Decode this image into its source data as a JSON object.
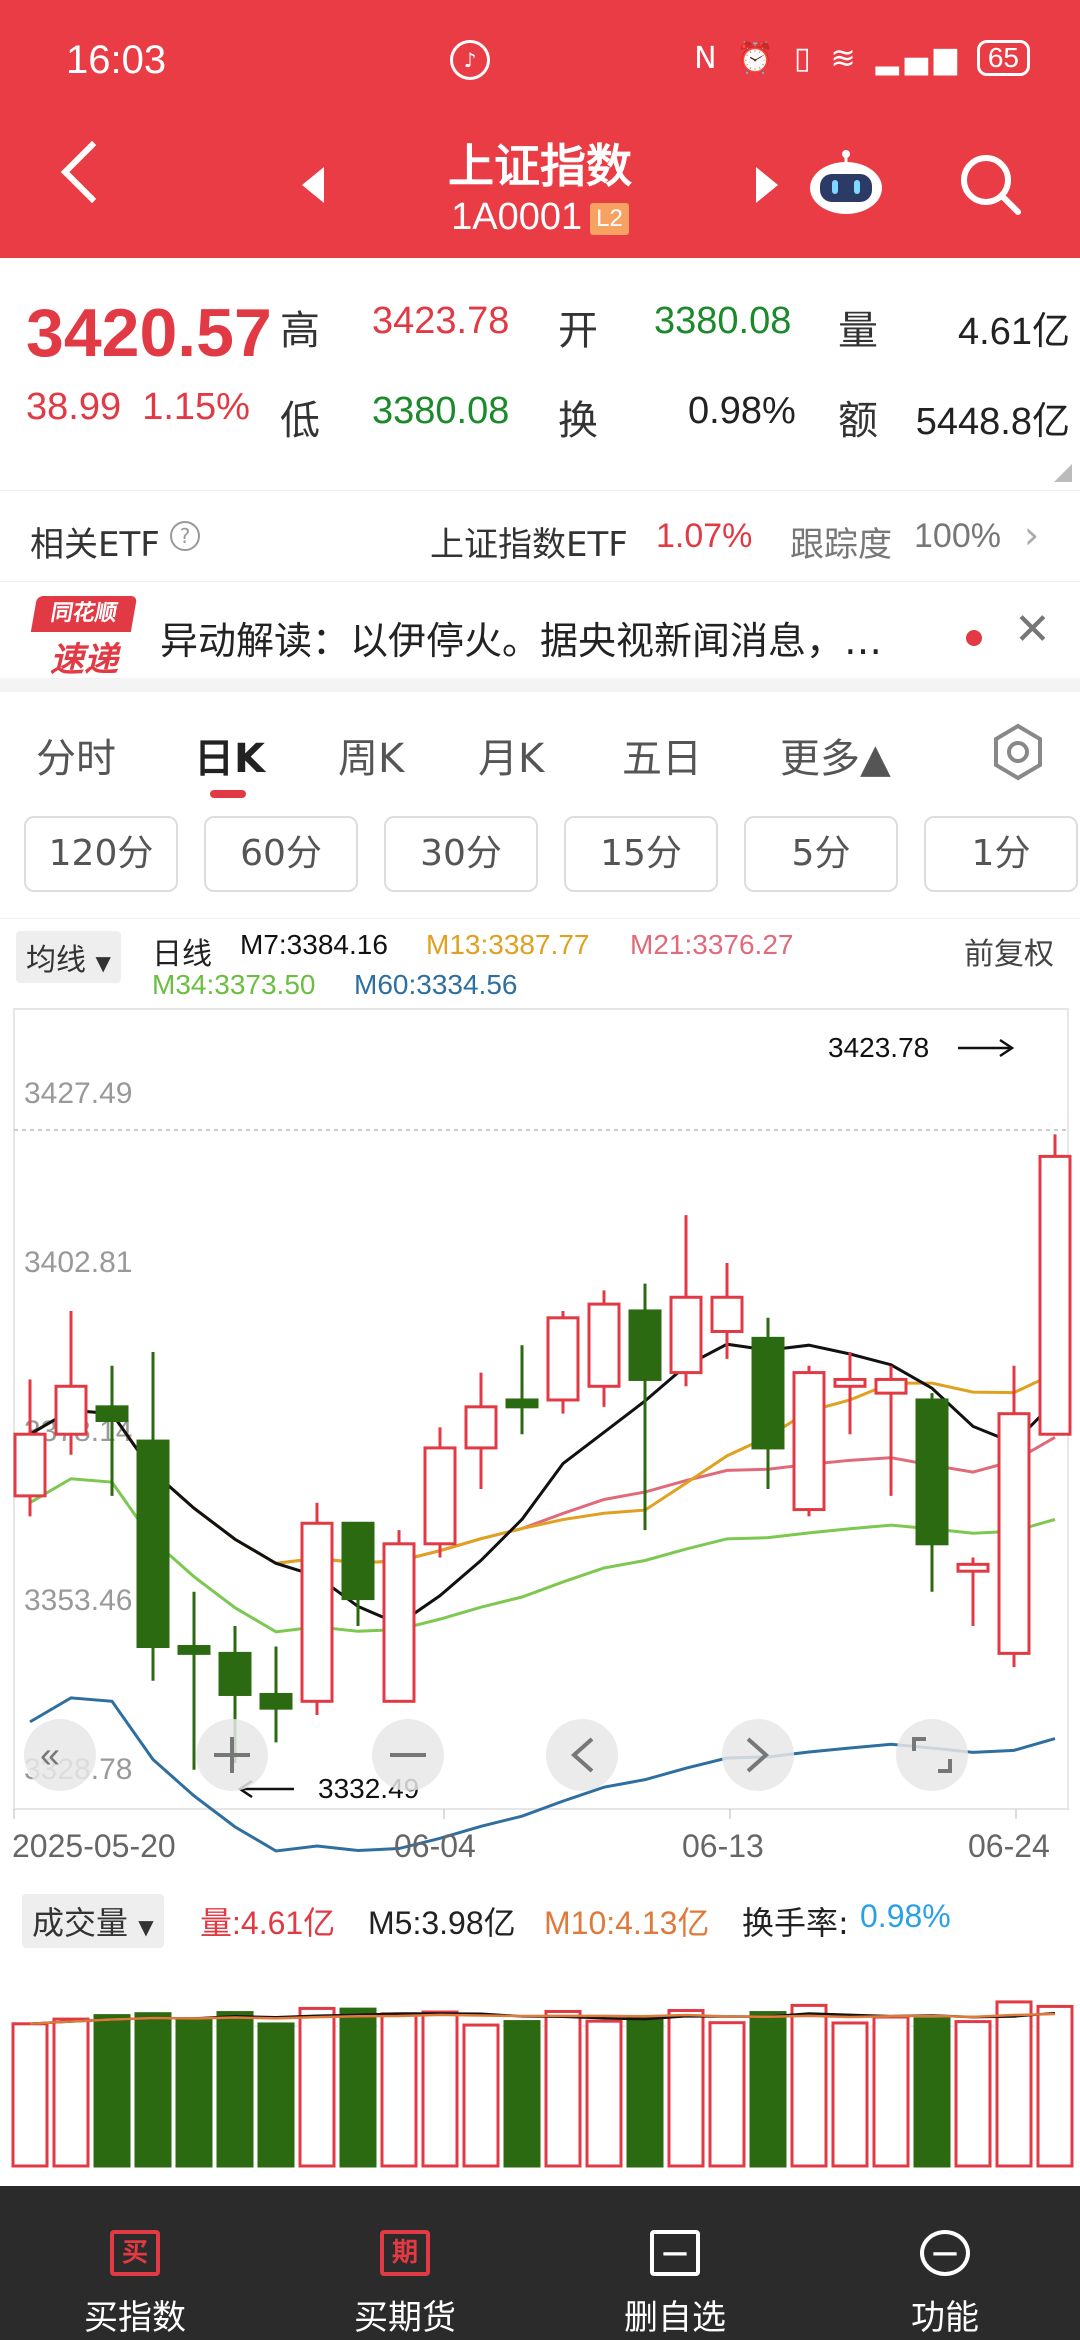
{
  "status": {
    "time": "16:03",
    "battery": "65"
  },
  "header": {
    "title": "上证指数",
    "code": "1A0001",
    "badge": "L2"
  },
  "quote": {
    "price": "3420.57",
    "change": "38.99",
    "change_pct": "1.15%",
    "high_label": "高",
    "high": "3423.78",
    "open_label": "开",
    "open": "3380.08",
    "volume_label": "量",
    "volume": "4.61亿",
    "low_label": "低",
    "low": "3380.08",
    "turnover_label": "换",
    "turnover": "0.98%",
    "amount_label": "额",
    "amount": "5448.8亿"
  },
  "etf": {
    "label": "相关ETF",
    "name": "上证指数ETF",
    "pct": "1.07%",
    "track_label": "跟踪度",
    "track": "100%"
  },
  "news": {
    "logo_top": "同花顺",
    "logo_bottom": "速递",
    "text": "异动解读：以伊停火。据央视新闻消息，…"
  },
  "tabs": [
    "分时",
    "日K",
    "周K",
    "月K",
    "五日",
    "更多▲"
  ],
  "periods": [
    "120分",
    "60分",
    "30分",
    "15分",
    "5分",
    "1分"
  ],
  "indicators": {
    "ma_select": "均线",
    "line_label": "日线",
    "m7": "M7:3384.16",
    "m13": "M13:3387.77",
    "m21": "M21:3376.27",
    "m34": "M34:3373.50",
    "m60": "M60:3334.56",
    "adjust": "前复权"
  },
  "colors": {
    "up": "#e23a44",
    "down": "#2b6a10",
    "m7": "#111111",
    "m13": "#e0a020",
    "m21": "#e06a7a",
    "m34": "#7cc850",
    "m60": "#2f6fa0",
    "header": "#e93c45"
  },
  "chart_data": {
    "type": "candlestick",
    "y_ticks": [
      "3427.49",
      "3402.81",
      "3378.14",
      "3353.46",
      "3328.78"
    ],
    "ylim": [
      3328.78,
      3427.49
    ],
    "x_ticks": [
      "2025-05-20",
      "06-04",
      "06-13",
      "06-24"
    ],
    "max_label": "3423.78",
    "min_label": "3332.49",
    "candles": [
      {
        "o": 3371,
        "c": 3380,
        "h": 3388,
        "l": 3368
      },
      {
        "o": 3380,
        "c": 3387,
        "h": 3398,
        "l": 3377
      },
      {
        "o": 3384,
        "c": 3382,
        "h": 3390,
        "l": 3371
      },
      {
        "o": 3379,
        "c": 3349,
        "h": 3392,
        "l": 3344
      },
      {
        "o": 3349,
        "c": 3348,
        "h": 3357,
        "l": 3331
      },
      {
        "o": 3348,
        "c": 3342,
        "h": 3352,
        "l": 3332
      },
      {
        "o": 3342,
        "c": 3340,
        "h": 3349,
        "l": 3335
      },
      {
        "o": 3341,
        "c": 3367,
        "h": 3370,
        "l": 3339
      },
      {
        "o": 3367,
        "c": 3356,
        "h": 3367,
        "l": 3352
      },
      {
        "o": 3341,
        "c": 3364,
        "h": 3366,
        "l": 3341
      },
      {
        "o": 3364,
        "c": 3378,
        "h": 3381,
        "l": 3362
      },
      {
        "o": 3378,
        "c": 3384,
        "h": 3389,
        "l": 3372
      },
      {
        "o": 3385,
        "c": 3384,
        "h": 3393,
        "l": 3380
      },
      {
        "o": 3385,
        "c": 3397,
        "h": 3398,
        "l": 3383
      },
      {
        "o": 3387,
        "c": 3399,
        "h": 3401,
        "l": 3384
      },
      {
        "o": 3398,
        "c": 3388,
        "h": 3402,
        "l": 3366
      },
      {
        "o": 3389,
        "c": 3400,
        "h": 3412,
        "l": 3387
      },
      {
        "o": 3395,
        "c": 3400,
        "h": 3405,
        "l": 3391
      },
      {
        "o": 3394,
        "c": 3378,
        "h": 3397,
        "l": 3372
      },
      {
        "o": 3369,
        "c": 3389,
        "h": 3390,
        "l": 3368
      },
      {
        "o": 3387,
        "c": 3388,
        "h": 3392,
        "l": 3380
      },
      {
        "o": 3386,
        "c": 3388,
        "h": 3390,
        "l": 3371
      },
      {
        "o": 3385,
        "c": 3364,
        "h": 3386,
        "l": 3357
      },
      {
        "o": 3360,
        "c": 3361,
        "h": 3362,
        "l": 3352
      },
      {
        "o": 3348,
        "c": 3383,
        "h": 3390,
        "l": 3346
      },
      {
        "o": 3380,
        "c": 3420.57,
        "h": 3423.78,
        "l": 3380.08
      }
    ],
    "volume_indicators": {
      "select": "成交量",
      "vol": "量:4.61亿",
      "m5": "M5:3.98亿",
      "m10": "M10:4.13亿",
      "turn_label": "换手率:",
      "turn": "0.98%"
    }
  },
  "bottom_nav": [
    {
      "icon": "买",
      "label": "买指数"
    },
    {
      "icon": "期",
      "label": "买期货"
    },
    {
      "icon": "—",
      "label": "删自选"
    },
    {
      "icon": "—",
      "label": "功能"
    }
  ]
}
